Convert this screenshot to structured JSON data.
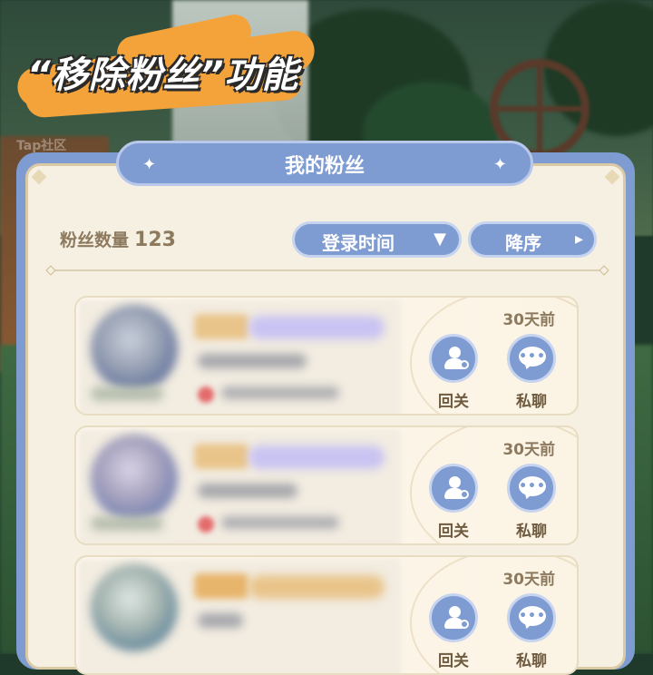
{
  "caption": "“移除粉丝”功能",
  "watermark": "Tap社区",
  "panel": {
    "title": "我的粉丝",
    "fans_label": "粉丝数量",
    "fans_count": "123",
    "sort_field_label": "登录时间",
    "sort_order_label": "降序"
  },
  "fans": [
    {
      "time": "30天前",
      "follow_label": "回关",
      "chat_label": "私聊"
    },
    {
      "time": "30天前",
      "follow_label": "回关",
      "chat_label": "私聊"
    },
    {
      "time": "30天前",
      "follow_label": "回关",
      "chat_label": "私聊"
    }
  ],
  "colors": {
    "accent_blue": "#7e9bd2",
    "panel_bg": "#f6f0e3",
    "brush_orange": "#f4a33a",
    "text_brown": "#8d7a5e"
  },
  "icons": {
    "follow": "person-follow-icon",
    "chat": "chat-bubble-icon",
    "sort_dropdown": "triangle-down-icon",
    "sort_order": "caret-right-icon"
  }
}
